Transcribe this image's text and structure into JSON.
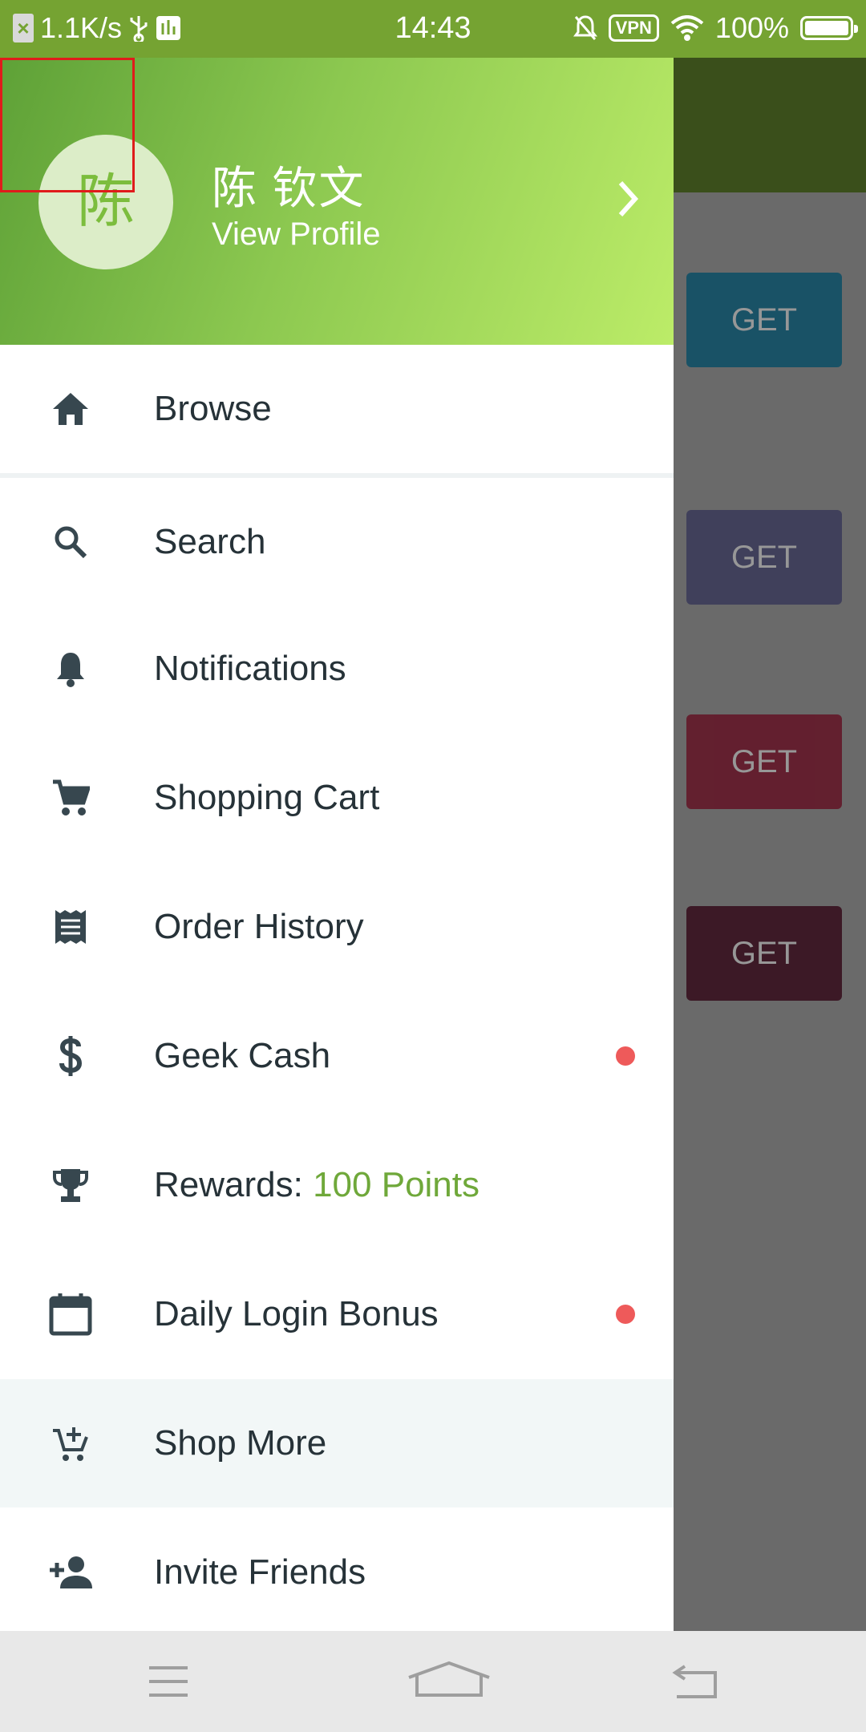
{
  "status_bar": {
    "net_speed": "1.1K/s",
    "time": "14:43",
    "vpn": "VPN",
    "battery": "100%"
  },
  "drawer": {
    "avatar_char": "陈",
    "user_name": "陈 钦文",
    "view_profile": "View Profile",
    "items": [
      {
        "label": "Browse",
        "icon": "home-icon"
      },
      {
        "label": "Search",
        "icon": "search-icon"
      },
      {
        "label": "Notifications",
        "icon": "bell-icon"
      },
      {
        "label": "Shopping Cart",
        "icon": "cart-icon"
      },
      {
        "label": "Order History",
        "icon": "receipt-icon"
      },
      {
        "label": "Geek Cash",
        "icon": "dollar-icon"
      },
      {
        "label": "Rewards: ",
        "points": "100 Points",
        "icon": "trophy-icon"
      },
      {
        "label": "Daily Login Bonus",
        "icon": "calendar-icon"
      },
      {
        "label": "Shop More",
        "icon": "add-cart-icon"
      },
      {
        "label": "Invite Friends",
        "icon": "add-person-icon"
      }
    ]
  },
  "background": {
    "get_buttons": [
      "GET",
      "GET",
      "GET",
      "GET"
    ],
    "colors": [
      "#155166",
      "#3e3e5b",
      "#631c2c",
      "#3a1523"
    ]
  },
  "colors": {
    "accent": "#75a332",
    "points": "#6fa83a",
    "badge": "#ee5a5a"
  }
}
